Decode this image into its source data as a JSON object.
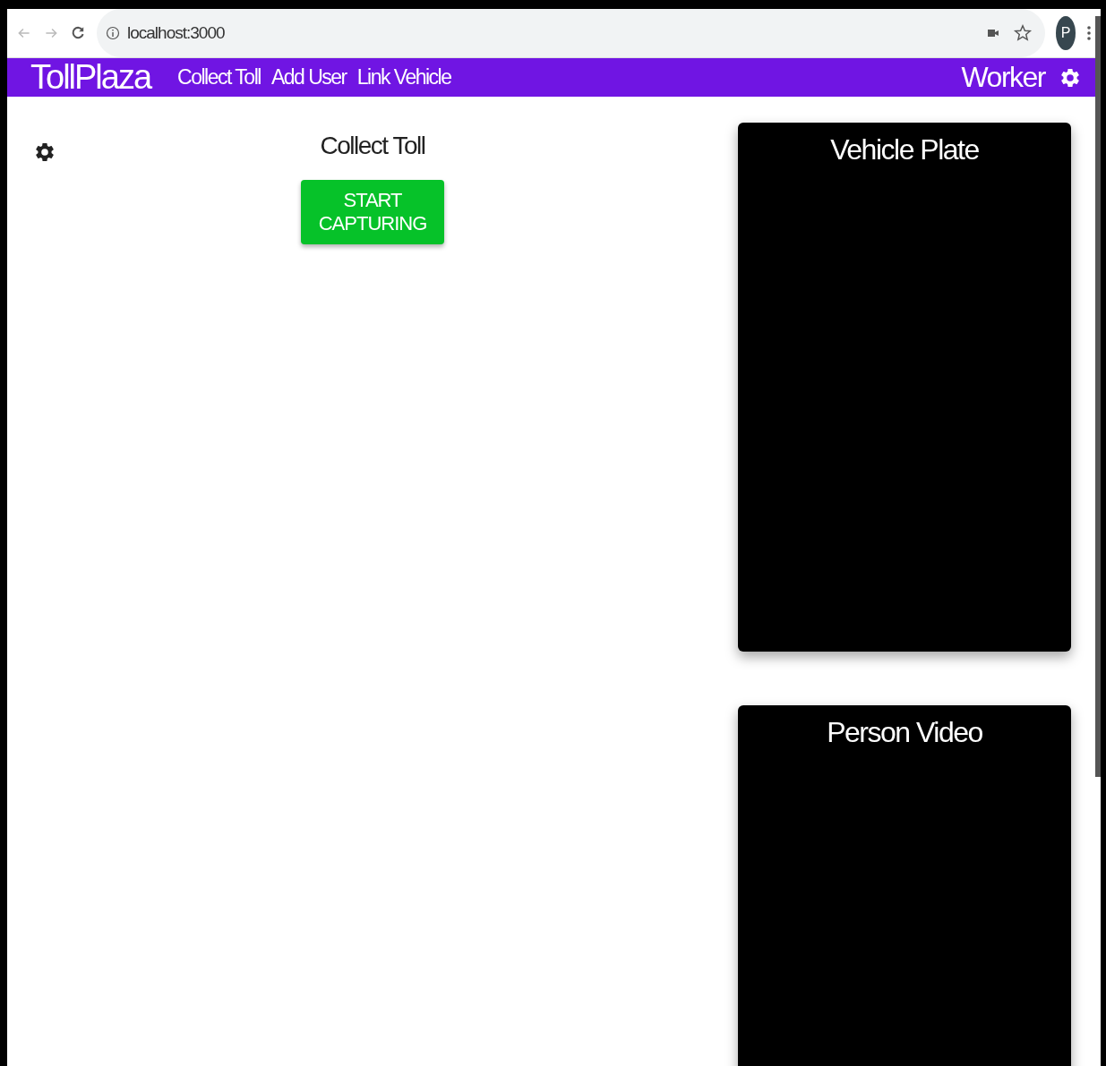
{
  "browser": {
    "url": "localhost:3000",
    "profile_initial": "P"
  },
  "navbar": {
    "brand": "TollPlaza",
    "links": [
      {
        "label": "Collect Toll"
      },
      {
        "label": "Add User"
      },
      {
        "label": "Link Vehicle"
      }
    ],
    "user": "Worker"
  },
  "main": {
    "title": "Collect Toll",
    "button": "START CAPTURING"
  },
  "panels": [
    {
      "title": "Vehicle Plate"
    },
    {
      "title": "Person Video"
    }
  ]
}
